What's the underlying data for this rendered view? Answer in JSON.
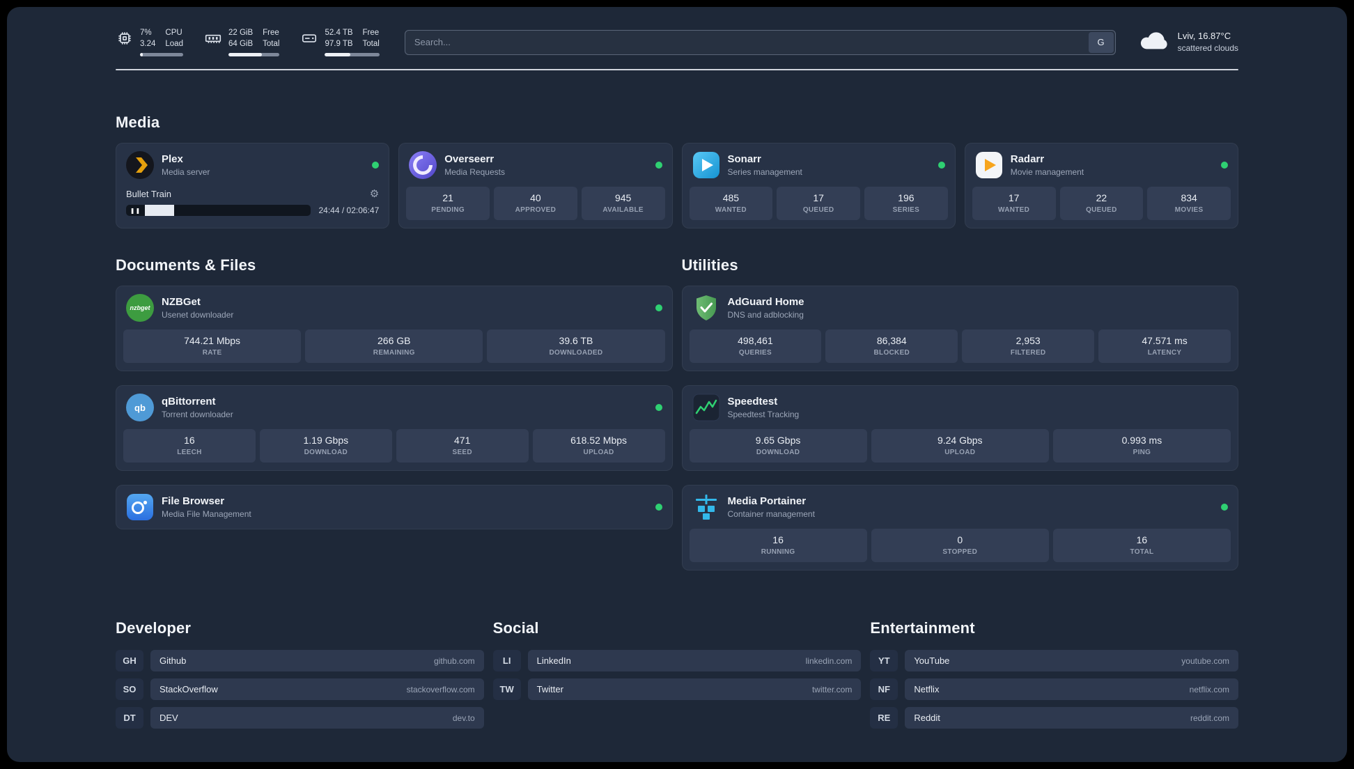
{
  "icons": {
    "gear": "⚙",
    "pause": "❚❚"
  },
  "colors": {
    "status_online": "#2fd072"
  },
  "topbar": {
    "resources": [
      {
        "name": "cpu",
        "v1": "7%",
        "v2": "3.24",
        "l1": "CPU",
        "l2": "Load",
        "progress": 7
      },
      {
        "name": "memory",
        "v1": "22 GiB",
        "v2": "64 GiB",
        "l1": "Free",
        "l2": "Total",
        "progress": 66
      },
      {
        "name": "disk",
        "v1": "52.4 TB",
        "v2": "97.9 TB",
        "l1": "Free",
        "l2": "Total",
        "progress": 47
      }
    ],
    "search": {
      "placeholder": "Search...",
      "button_label": "G"
    },
    "weather": {
      "location": "Lviv, 16.87°C",
      "condition": "scattered clouds"
    }
  },
  "sections": {
    "media": {
      "title": "Media",
      "apps": [
        {
          "name": "Plex",
          "desc": "Media server",
          "status": "online",
          "player": {
            "track": "Bullet Train",
            "time": "24:44 / 02:06:47",
            "progress": 16
          }
        },
        {
          "name": "Overseerr",
          "desc": "Media Requests",
          "status": "online",
          "stats": [
            {
              "value": "21",
              "label": "PENDING"
            },
            {
              "value": "40",
              "label": "APPROVED"
            },
            {
              "value": "945",
              "label": "AVAILABLE"
            }
          ]
        },
        {
          "name": "Sonarr",
          "desc": "Series management",
          "status": "online",
          "stats": [
            {
              "value": "485",
              "label": "WANTED"
            },
            {
              "value": "17",
              "label": "QUEUED"
            },
            {
              "value": "196",
              "label": "SERIES"
            }
          ]
        },
        {
          "name": "Radarr",
          "desc": "Movie management",
          "status": "online",
          "stats": [
            {
              "value": "17",
              "label": "WANTED"
            },
            {
              "value": "22",
              "label": "QUEUED"
            },
            {
              "value": "834",
              "label": "MOVIES"
            }
          ]
        }
      ]
    },
    "documents": {
      "title": "Documents & Files",
      "apps": [
        {
          "name": "NZBGet",
          "desc": "Usenet downloader",
          "status": "online",
          "icon_text": "nzbget",
          "stats": [
            {
              "value": "744.21 Mbps",
              "label": "RATE"
            },
            {
              "value": "266 GB",
              "label": "REMAINING"
            },
            {
              "value": "39.6 TB",
              "label": "DOWNLOADED"
            }
          ]
        },
        {
          "name": "qBittorrent",
          "desc": "Torrent downloader",
          "status": "online",
          "icon_text": "qb",
          "stats": [
            {
              "value": "16",
              "label": "LEECH"
            },
            {
              "value": "1.19 Gbps",
              "label": "DOWNLOAD"
            },
            {
              "value": "471",
              "label": "SEED"
            },
            {
              "value": "618.52 Mbps",
              "label": "UPLOAD"
            }
          ]
        },
        {
          "name": "File Browser",
          "desc": "Media File Management",
          "status": "online",
          "stats": []
        }
      ]
    },
    "utilities": {
      "title": "Utilities",
      "apps": [
        {
          "name": "AdGuard Home",
          "desc": "DNS and adblocking",
          "stats": [
            {
              "value": "498,461",
              "label": "QUERIES"
            },
            {
              "value": "86,384",
              "label": "BLOCKED"
            },
            {
              "value": "2,953",
              "label": "FILTERED"
            },
            {
              "value": "47.571 ms",
              "label": "LATENCY"
            }
          ]
        },
        {
          "name": "Speedtest",
          "desc": "Speedtest Tracking",
          "stats": [
            {
              "value": "9.65 Gbps",
              "label": "DOWNLOAD"
            },
            {
              "value": "9.24 Gbps",
              "label": "UPLOAD"
            },
            {
              "value": "0.993 ms",
              "label": "PING"
            }
          ]
        },
        {
          "name": "Media Portainer",
          "desc": "Container management",
          "status": "online",
          "stats": [
            {
              "value": "16",
              "label": "RUNNING"
            },
            {
              "value": "0",
              "label": "STOPPED"
            },
            {
              "value": "16",
              "label": "TOTAL"
            }
          ]
        }
      ]
    }
  },
  "bookmarks": [
    {
      "title": "Developer",
      "links": [
        {
          "abbr": "GH",
          "name": "Github",
          "url": "github.com"
        },
        {
          "abbr": "SO",
          "name": "StackOverflow",
          "url": "stackoverflow.com"
        },
        {
          "abbr": "DT",
          "name": "DEV",
          "url": "dev.to"
        }
      ]
    },
    {
      "title": "Social",
      "links": [
        {
          "abbr": "LI",
          "name": "LinkedIn",
          "url": "linkedin.com"
        },
        {
          "abbr": "TW",
          "name": "Twitter",
          "url": "twitter.com"
        }
      ]
    },
    {
      "title": "Entertainment",
      "links": [
        {
          "abbr": "YT",
          "name": "YouTube",
          "url": "youtube.com"
        },
        {
          "abbr": "NF",
          "name": "Netflix",
          "url": "netflix.com"
        },
        {
          "abbr": "RE",
          "name": "Reddit",
          "url": "reddit.com"
        }
      ]
    }
  ]
}
